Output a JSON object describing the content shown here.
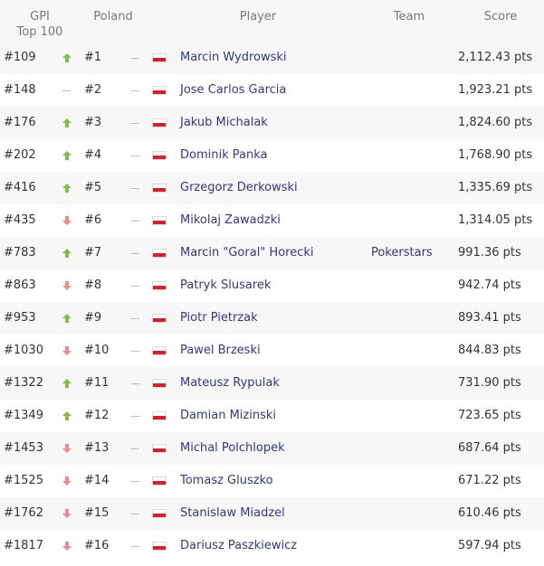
{
  "table": {
    "headers": {
      "gpi_line1": "GPI",
      "gpi_line2": "Top 100",
      "poland": "Poland",
      "player": "Player",
      "team": "Team",
      "score": "Score"
    },
    "colors": {
      "up": "#7cc242",
      "down": "#f08a8a",
      "flag_red": "#d81e2c",
      "link": "#2b3a8c"
    },
    "rows": [
      {
        "gpi": "#109",
        "gpi_trend": "up",
        "poland": "#1",
        "poland_trend": "none",
        "flag": "poland-flag",
        "player": "Marcin Wydrowski",
        "team": "",
        "score": "2,112.43 pts"
      },
      {
        "gpi": "#148",
        "gpi_trend": "none",
        "poland": "#2",
        "poland_trend": "none",
        "flag": "poland-flag",
        "player": "Jose Carlos Garcia",
        "team": "",
        "score": "1,923.21 pts"
      },
      {
        "gpi": "#176",
        "gpi_trend": "up",
        "poland": "#3",
        "poland_trend": "none",
        "flag": "poland-flag",
        "player": "Jakub Michalak",
        "team": "",
        "score": "1,824.60 pts"
      },
      {
        "gpi": "#202",
        "gpi_trend": "up",
        "poland": "#4",
        "poland_trend": "none",
        "flag": "poland-flag",
        "player": "Dominik Panka",
        "team": "",
        "score": "1,768.90 pts"
      },
      {
        "gpi": "#416",
        "gpi_trend": "up",
        "poland": "#5",
        "poland_trend": "none",
        "flag": "poland-flag",
        "player": "Grzegorz Derkowski",
        "team": "",
        "score": "1,335.69 pts"
      },
      {
        "gpi": "#435",
        "gpi_trend": "down",
        "poland": "#6",
        "poland_trend": "none",
        "flag": "poland-flag",
        "player": "Mikolaj Zawadzki",
        "team": "",
        "score": "1,314.05 pts"
      },
      {
        "gpi": "#783",
        "gpi_trend": "up",
        "poland": "#7",
        "poland_trend": "none",
        "flag": "poland-flag",
        "player": "Marcin \"Goral\" Horecki",
        "team": "Pokerstars",
        "score": "991.36 pts"
      },
      {
        "gpi": "#863",
        "gpi_trend": "down",
        "poland": "#8",
        "poland_trend": "none",
        "flag": "poland-flag",
        "player": "Patryk Slusarek",
        "team": "",
        "score": "942.74 pts"
      },
      {
        "gpi": "#953",
        "gpi_trend": "up",
        "poland": "#9",
        "poland_trend": "none",
        "flag": "poland-flag",
        "player": "Piotr Pietrzak",
        "team": "",
        "score": "893.41 pts"
      },
      {
        "gpi": "#1030",
        "gpi_trend": "down",
        "poland": "#10",
        "poland_trend": "none",
        "flag": "poland-flag",
        "player": "Pawel Brzeski",
        "team": "",
        "score": "844.83 pts"
      },
      {
        "gpi": "#1322",
        "gpi_trend": "up",
        "poland": "#11",
        "poland_trend": "none",
        "flag": "poland-flag",
        "player": "Mateusz Rypulak",
        "team": "",
        "score": "731.90 pts"
      },
      {
        "gpi": "#1349",
        "gpi_trend": "up",
        "poland": "#12",
        "poland_trend": "none",
        "flag": "poland-flag",
        "player": "Damian Mizinski",
        "team": "",
        "score": "723.65 pts"
      },
      {
        "gpi": "#1453",
        "gpi_trend": "down",
        "poland": "#13",
        "poland_trend": "none",
        "flag": "poland-flag",
        "player": "Michal Polchlopek",
        "team": "",
        "score": "687.64 pts"
      },
      {
        "gpi": "#1525",
        "gpi_trend": "down",
        "poland": "#14",
        "poland_trend": "none",
        "flag": "poland-flag",
        "player": "Tomasz Gluszko",
        "team": "",
        "score": "671.22 pts"
      },
      {
        "gpi": "#1762",
        "gpi_trend": "down",
        "poland": "#15",
        "poland_trend": "none",
        "flag": "poland-flag",
        "player": "Stanislaw Miadzel",
        "team": "",
        "score": "610.46 pts"
      },
      {
        "gpi": "#1817",
        "gpi_trend": "down",
        "poland": "#16",
        "poland_trend": "none",
        "flag": "poland-flag",
        "player": "Dariusz Paszkiewicz",
        "team": "",
        "score": "597.94 pts"
      }
    ]
  }
}
